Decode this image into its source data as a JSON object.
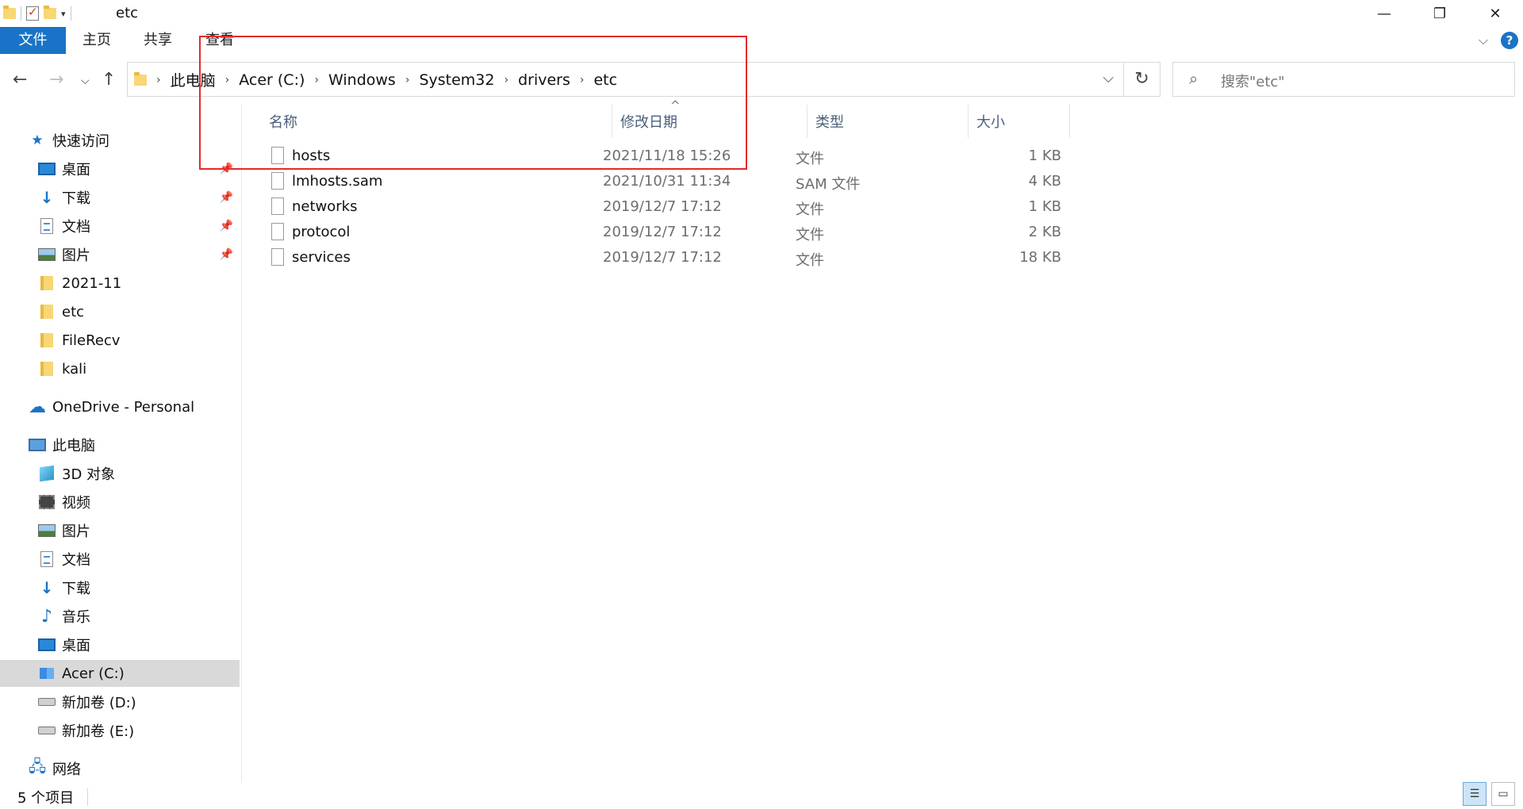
{
  "window": {
    "title": "etc",
    "minimize_glyph": "—",
    "restore_glyph": "❐",
    "close_glyph": "✕"
  },
  "ribbon": {
    "tabs": [
      "文件",
      "主页",
      "共享",
      "查看"
    ]
  },
  "address_bar": {
    "path": [
      "此电脑",
      "Acer (C:)",
      "Windows",
      "System32",
      "drivers",
      "etc"
    ],
    "search_placeholder": "搜索\"etc\""
  },
  "sidebar": {
    "quick_access_label": "快速访问",
    "quick_access": [
      {
        "label": "桌面",
        "icon": "desktop-icon",
        "pinned": true
      },
      {
        "label": "下载",
        "icon": "download-icon",
        "pinned": true
      },
      {
        "label": "文档",
        "icon": "document-icon",
        "pinned": true
      },
      {
        "label": "图片",
        "icon": "pictures-icon",
        "pinned": true
      },
      {
        "label": "2021-11",
        "icon": "folder-icon",
        "pinned": false
      },
      {
        "label": "etc",
        "icon": "folder-icon",
        "pinned": false
      },
      {
        "label": "FileRecv",
        "icon": "folder-icon",
        "pinned": false
      },
      {
        "label": "kali",
        "icon": "folder-icon",
        "pinned": false
      }
    ],
    "onedrive_label": "OneDrive - Personal",
    "this_pc_label": "此电脑",
    "this_pc": [
      {
        "label": "3D 对象",
        "icon": "3d-objects-icon"
      },
      {
        "label": "视频",
        "icon": "videos-icon"
      },
      {
        "label": "图片",
        "icon": "pictures-icon"
      },
      {
        "label": "文档",
        "icon": "document-icon"
      },
      {
        "label": "下载",
        "icon": "download-icon"
      },
      {
        "label": "音乐",
        "icon": "music-icon"
      },
      {
        "label": "桌面",
        "icon": "desktop-icon"
      },
      {
        "label": "Acer (C:)",
        "icon": "c-drive-icon",
        "selected": true
      },
      {
        "label": "新加卷 (D:)",
        "icon": "drive-icon"
      },
      {
        "label": "新加卷 (E:)",
        "icon": "drive-icon"
      }
    ],
    "network_label": "网络"
  },
  "file_list": {
    "columns": [
      "名称",
      "修改日期",
      "类型",
      "大小"
    ],
    "rows": [
      {
        "name": "hosts",
        "date": "2021/11/18 15:26",
        "type": "文件",
        "size": "1 KB"
      },
      {
        "name": "lmhosts.sam",
        "date": "2021/10/31 11:34",
        "type": "SAM 文件",
        "size": "4 KB"
      },
      {
        "name": "networks",
        "date": "2019/12/7 17:12",
        "type": "文件",
        "size": "1 KB"
      },
      {
        "name": "protocol",
        "date": "2019/12/7 17:12",
        "type": "文件",
        "size": "2 KB"
      },
      {
        "name": "services",
        "date": "2019/12/7 17:12",
        "type": "文件",
        "size": "18 KB"
      }
    ]
  },
  "status_bar": {
    "item_count": "5 个项目"
  },
  "colors": {
    "accent": "#1a73c6",
    "highlight_border": "#e32a2a",
    "selected_bg": "#d9d9d9"
  }
}
